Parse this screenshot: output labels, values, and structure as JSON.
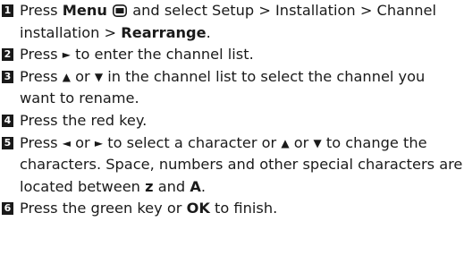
{
  "steps": [
    {
      "number": "1",
      "press": "Press",
      "menu_label": "Menu",
      "menu_icon": "menu-icon",
      "text_after_icon": "and select Setup > Installation > Channel installation >",
      "rearrange_label": "Rearrange",
      "end_punct": "."
    },
    {
      "number": "2",
      "press": "Press",
      "right_arrow": "►",
      "text_after": "to enter the channel list."
    },
    {
      "number": "3",
      "press": "Press",
      "up_arrow": "▲",
      "or_text": "or",
      "down_arrow": "▼",
      "text_after": "in the channel list to select the channel you want to rename."
    },
    {
      "number": "4",
      "text": "Press the red key."
    },
    {
      "number": "5",
      "press": "Press",
      "left_arrow": "◄",
      "or1": "or",
      "right_arrow": "►",
      "mid_text": "to select a character or",
      "up_arrow": "▲",
      "or2": "or",
      "down_arrow": "▼",
      "text_before_z": "to change the characters. Space, numbers and other special characters are located between",
      "z_label": "z",
      "and_text": "and",
      "a_label": "A",
      "end_punct": "."
    },
    {
      "number": "6",
      "text_before_ok": "Press the green key or",
      "ok_label": "OK",
      "text_after_ok": "to finish."
    }
  ]
}
